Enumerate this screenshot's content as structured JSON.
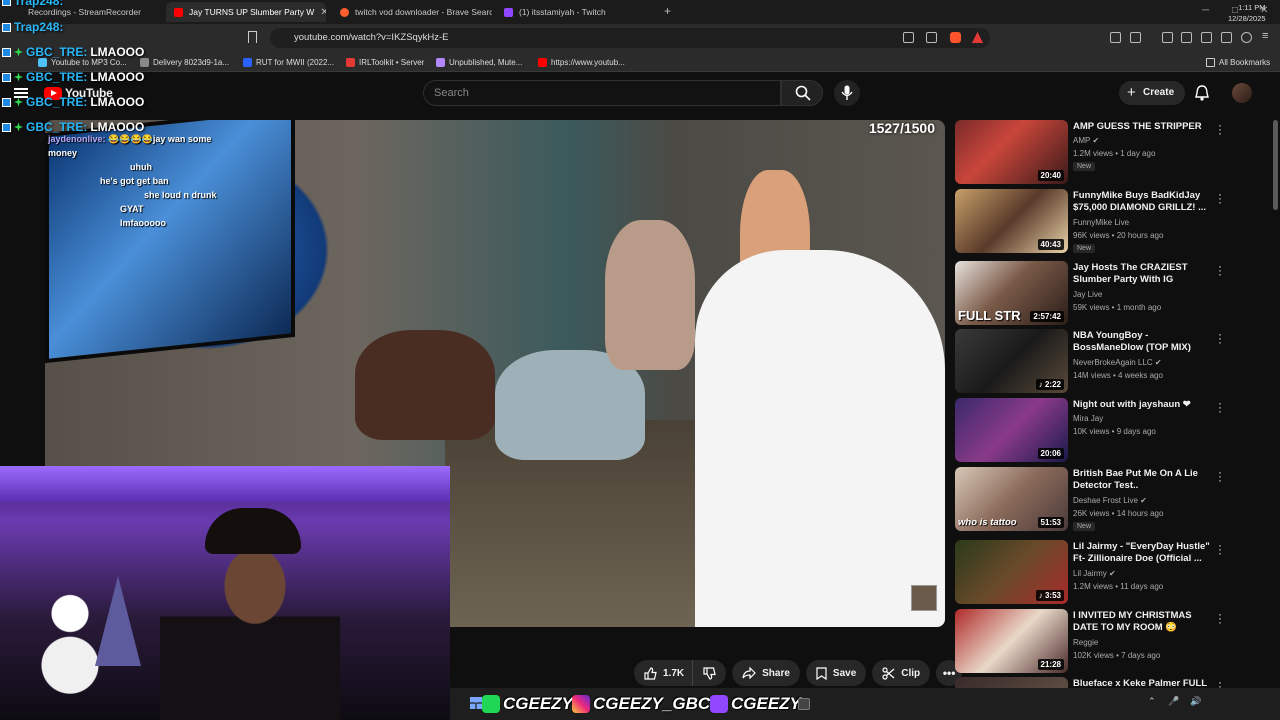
{
  "browser": {
    "tabs": [
      {
        "label": "Recordings - StreamRecorder",
        "active": false
      },
      {
        "label": "Jay TURNS UP Slumber Party W",
        "active": true
      },
      {
        "label": "twitch vod downloader - Brave Searc",
        "active": false
      },
      {
        "label": "(1) itsstamiyah - Twitch",
        "active": false
      }
    ],
    "new_tab": "+",
    "url": "youtube.com/watch?v=IKZSqykHz-E",
    "bookmarks": [
      "Youtube to MP3 Co...",
      "Delivery 8023d9-1a...",
      "RUT for MWII (2022...",
      "IRLToolkit • Server",
      "Unpublished, Mute...",
      "https://www.youtub..."
    ],
    "all_bookmarks": "All Bookmarks"
  },
  "youtube": {
    "logo": "YouTube",
    "search_placeholder": "Search",
    "create_label": "Create",
    "video_counter": "1527/1500",
    "actions": {
      "like_count": "1.7K",
      "share": "Share",
      "save": "Save",
      "clip": "Clip"
    },
    "recommendations": [
      {
        "title": "AMP GUESS THE STRIPPER",
        "channel": "AMP",
        "meta": "1.2M views • 1 day ago",
        "badge": "New",
        "duration": "20:40"
      },
      {
        "title": "FunnyMike Buys BadKidJay $75,000 DIAMOND GRILLZ! ...",
        "channel": "FunnyMike Live",
        "meta": "96K views • 20 hours ago",
        "badge": "New",
        "duration": "40:43"
      },
      {
        "title": "Jay Hosts The CRAZIEST Slumber Party With IG Baddies...",
        "channel": "Jay Live",
        "meta": "59K views • 1 month ago",
        "badge": "",
        "duration": "2:57:42",
        "overlay": "FULL STR"
      },
      {
        "title": "NBA YoungBoy - BossManeDlow (TOP MIX)",
        "channel": "NeverBrokeAgain LLC",
        "meta": "14M views • 4 weeks ago",
        "badge": "",
        "duration": "2:22"
      },
      {
        "title": "Night out with jayshaun ❤",
        "channel": "Mira Jay",
        "meta": "10K views • 9 days ago",
        "badge": "",
        "duration": "20:06"
      },
      {
        "title": "British Bae Put Me On A Lie Detector Test..",
        "channel": "Deshae Frost Live",
        "meta": "26K views • 14 hours ago",
        "badge": "New",
        "duration": "51:53",
        "overlay": "who is tattoo"
      },
      {
        "title": "Lil Jairmy - \"EveryDay Hustle\" Ft- Zillionaire Doe (Official ...",
        "channel": "Lil Jairmy",
        "meta": "1.2M views • 11 days ago",
        "badge": "",
        "duration": "3:53"
      },
      {
        "title": "I INVITED MY CHRISTMAS DATE TO MY ROOM 😳",
        "channel": "Reggie",
        "meta": "102K views • 7 days ago",
        "badge": "",
        "duration": "21:28"
      },
      {
        "title": "Blueface x Keke Palmer FULL",
        "channel": "",
        "meta": "",
        "badge": "",
        "duration": ""
      }
    ]
  },
  "overlay_chat": [
    {
      "name": "Trap248:",
      "msg": ""
    },
    {
      "name": "Trap248:",
      "msg": ""
    },
    {
      "name": "GBC_TRE:",
      "msg": "LMAOOO"
    },
    {
      "name": "GBC_TRE:",
      "msg": "LMAOOO"
    },
    {
      "name": "GBC_TRE:",
      "msg": "LMAOOO"
    },
    {
      "name": "GBC_TRE:",
      "msg": "LMAOOO"
    }
  ],
  "stream_chat": [
    {
      "name": "jaydenonlive:",
      "msg": "😂😂😂😂jay wan some"
    },
    {
      "name": "",
      "msg": "money"
    },
    {
      "name": "",
      "msg": "uhuh"
    },
    {
      "name": "",
      "msg": "he's got get ban"
    },
    {
      "name": "",
      "msg": "she loud n drunk"
    },
    {
      "name": "",
      "msg": "GYAT"
    },
    {
      "name": "",
      "msg": "lmfaooooo"
    }
  ],
  "social_bar": [
    {
      "handle": "CGEEZY",
      "color": "#1fd655"
    },
    {
      "handle": "CGEEZY_GBC",
      "color": "#d62976"
    },
    {
      "handle": "CGEEZY",
      "color": "#9146ff"
    }
  ],
  "clock": {
    "time": "1:11 PM",
    "date": "12/28/2025"
  }
}
